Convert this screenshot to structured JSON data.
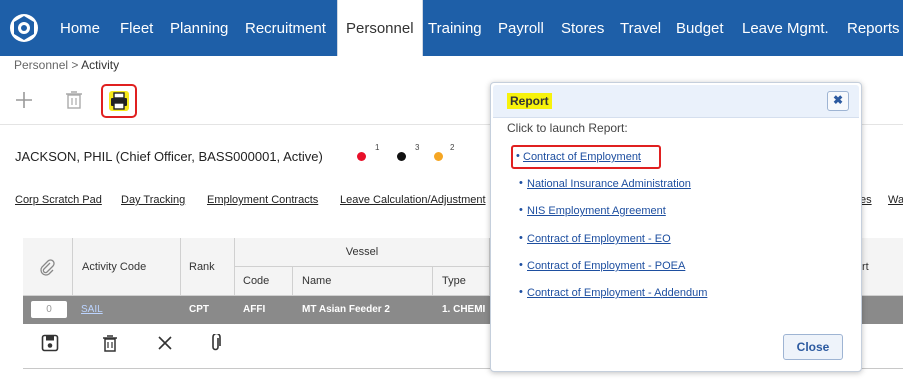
{
  "nav": {
    "logo_icon": "company-logo",
    "items": [
      {
        "label": "Home"
      },
      {
        "label": "Fleet"
      },
      {
        "label": "Planning"
      },
      {
        "label": "Recruitment"
      },
      {
        "label": "Personnel",
        "active": true
      },
      {
        "label": "Training"
      },
      {
        "label": "Payroll"
      },
      {
        "label": "Stores"
      },
      {
        "label": "Travel"
      },
      {
        "label": "Budget"
      },
      {
        "label": "Leave Mgmt."
      },
      {
        "label": "Reports"
      }
    ],
    "color": "#1e5fa8"
  },
  "breadcrumb": {
    "parent": "Personnel",
    "separator": ">",
    "current": "Activity"
  },
  "toolbar": {
    "icons": [
      "add-icon",
      "delete-icon",
      "print-icon"
    ]
  },
  "person": {
    "text": "JACKSON, PHIL (Chief Officer, BASS000001, Active)",
    "indicators": [
      {
        "color": "#e8102a",
        "count": "1"
      },
      {
        "color": "#111111",
        "count": "3"
      },
      {
        "color": "#f5a623",
        "count": "2"
      }
    ]
  },
  "links": [
    "Corp Scratch Pad",
    "Day Tracking",
    "Employment Contracts",
    "Leave Calculation/Adjustment",
    "es",
    "Wa"
  ],
  "table": {
    "headers": {
      "attachment_icon": "paperclip-icon",
      "activity_code": "Activity Code",
      "rank": "Rank",
      "vessel": "Vessel",
      "code": "Code",
      "name": "Name",
      "type": "Type",
      "extra": "rt"
    },
    "row": {
      "attachments": "0",
      "activity_code": "SAIL",
      "rank": "CPT",
      "code": "AFFI",
      "name": "MT Asian Feeder 2",
      "type": "1. CHEMI"
    },
    "row_actions": [
      "save-icon",
      "delete-icon",
      "close-icon",
      "paperclip-icon"
    ]
  },
  "popup": {
    "title": "Report",
    "subtitle": "Click to launch Report:",
    "reports": [
      "Contract of Employment",
      "National Insurance Administration",
      "NIS Employment Agreement",
      "Contract of Employment - EO",
      "Contract of Employment - POEA",
      "Contract of Employment - Addendum"
    ],
    "close_label": "Close",
    "close_x": "✖"
  }
}
